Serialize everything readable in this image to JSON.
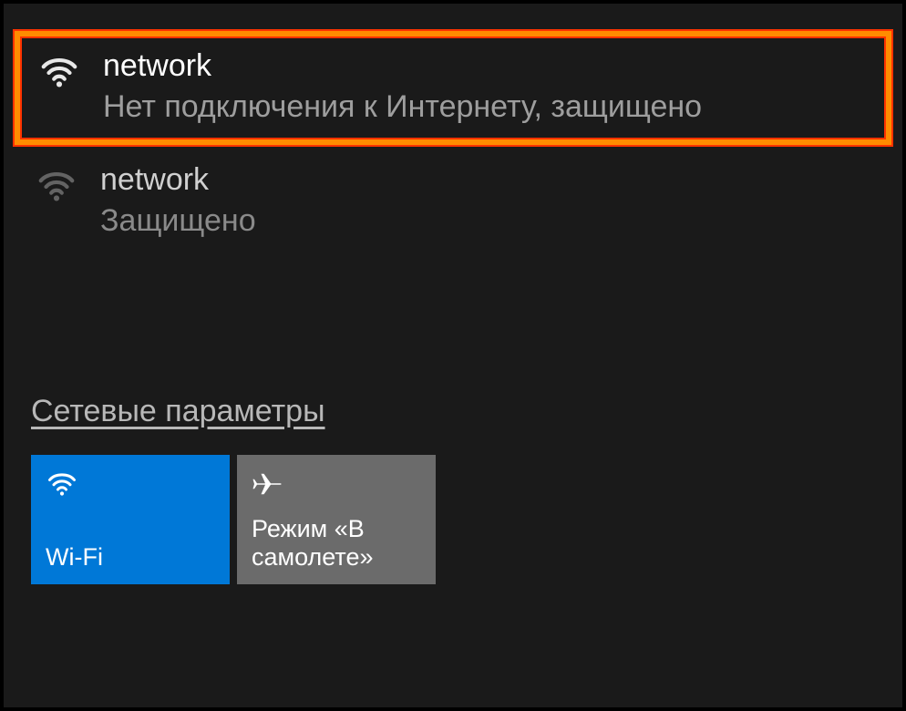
{
  "networks": [
    {
      "name": "network",
      "status": "Нет подключения к Интернету, защищено",
      "highlighted": true
    },
    {
      "name": "network",
      "status": "Защищено",
      "highlighted": false
    }
  ],
  "settings": {
    "link_label": "Сетевые параметры"
  },
  "tiles": {
    "wifi": {
      "label": "Wi-Fi"
    },
    "airplane": {
      "label": "Режим «В самолете»"
    }
  }
}
